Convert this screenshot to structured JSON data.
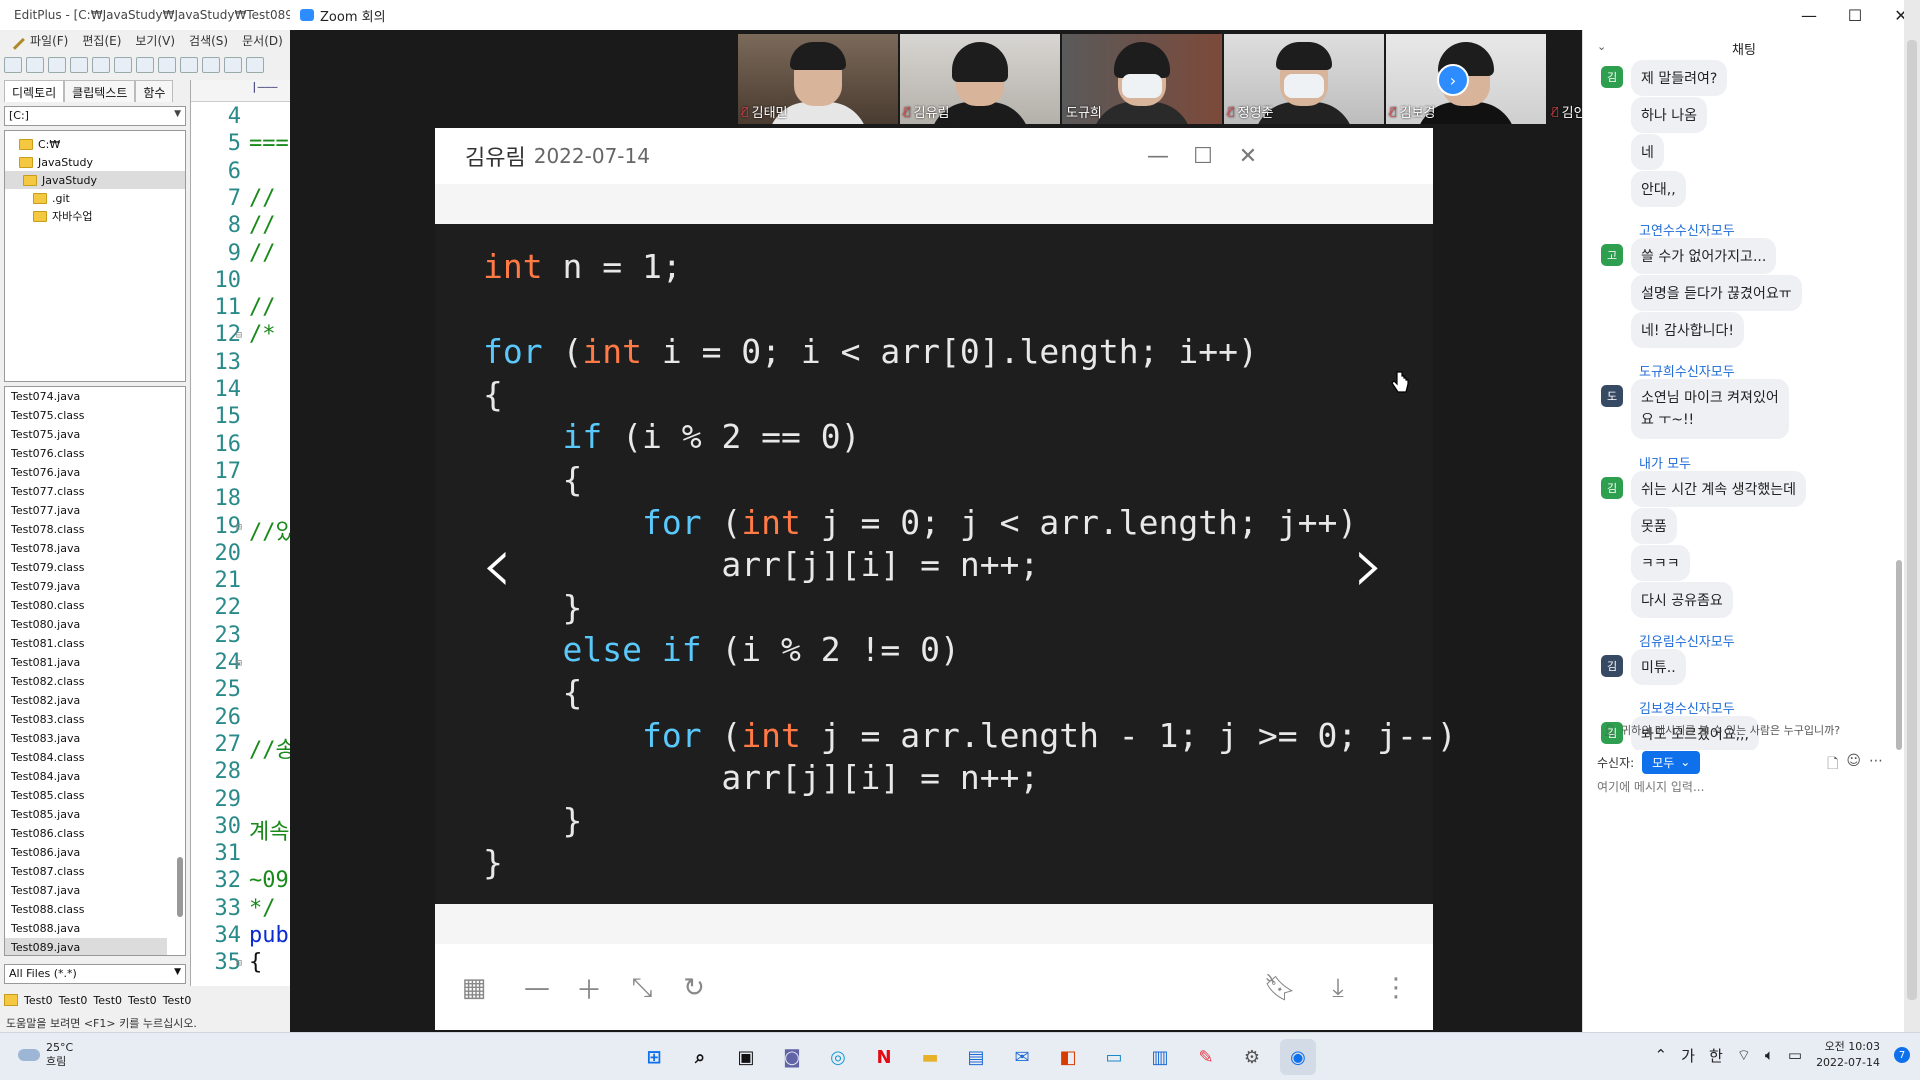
{
  "editplus": {
    "title": "EditPlus - [C:₩JavaStudy₩JavaStudy₩Test089.ja",
    "menu": [
      "파일(F)",
      "편집(E)",
      "보기(V)",
      "검색(S)",
      "문서(D)"
    ],
    "panel_tabs": [
      "디렉토리",
      "클립텍스트",
      "함수"
    ],
    "drive": "[C:]",
    "tree": [
      "C:₩",
      "JavaStudy",
      "JavaStudy",
      ".git",
      "자바수업"
    ],
    "files": [
      "Test074.java",
      "Test075.class",
      "Test075.java",
      "Test076.class",
      "Test076.java",
      "Test077.class",
      "Test077.java",
      "Test078.class",
      "Test078.java",
      "Test079.class",
      "Test079.java",
      "Test080.class",
      "Test080.java",
      "Test081.class",
      "Test081.java",
      "Test082.class",
      "Test082.java",
      "Test083.class",
      "Test083.java",
      "Test084.class",
      "Test084.java",
      "Test085.class",
      "Test085.java",
      "Test086.class",
      "Test086.java",
      "Test087.class",
      "Test087.java",
      "Test088.class",
      "Test088.java",
      "Test089.java"
    ],
    "filter": "All Files (*.*)",
    "ruler": "|———",
    "lines": [
      {
        "n": "4",
        "code": ""
      },
      {
        "n": "5",
        "code": "===",
        "cls": "green"
      },
      {
        "n": "6",
        "code": ""
      },
      {
        "n": "7",
        "code": "//",
        "cls": "green"
      },
      {
        "n": "8",
        "code": "//",
        "cls": "green"
      },
      {
        "n": "9",
        "code": "//",
        "cls": "green"
      },
      {
        "n": "10",
        "code": ""
      },
      {
        "n": "11",
        "code": "//",
        "cls": "green"
      },
      {
        "n": "12",
        "code": "/*",
        "cls": "green",
        "fold": "⊟"
      },
      {
        "n": "13",
        "code": ""
      },
      {
        "n": "14",
        "code": ""
      },
      {
        "n": "15",
        "code": ""
      },
      {
        "n": "16",
        "code": ""
      },
      {
        "n": "17",
        "code": ""
      },
      {
        "n": "18",
        "code": ""
      },
      {
        "n": "19",
        "code": "//있",
        "cls": "green",
        "fold": "⊟"
      },
      {
        "n": "20",
        "code": ""
      },
      {
        "n": "21",
        "code": ""
      },
      {
        "n": "22",
        "code": ""
      },
      {
        "n": "23",
        "code": ""
      },
      {
        "n": "24",
        "code": "",
        "fold": "⊟"
      },
      {
        "n": "25",
        "code": ""
      },
      {
        "n": "26",
        "code": ""
      },
      {
        "n": "27",
        "code": "//송",
        "cls": "green"
      },
      {
        "n": "28",
        "code": ""
      },
      {
        "n": "29",
        "code": ""
      },
      {
        "n": "30",
        "code": "계속",
        "cls": "green"
      },
      {
        "n": "31",
        "code": ""
      },
      {
        "n": "32",
        "code": "~09",
        "cls": "green"
      },
      {
        "n": "33",
        "code": "*/",
        "cls": "green"
      },
      {
        "n": "34",
        "code": "pub",
        "cls": "blue"
      },
      {
        "n": "35",
        "code": "{",
        "fold": "⊟"
      }
    ],
    "doc_tabs": [
      "Test0",
      "Test0",
      "Test0",
      "Test0",
      "Test0"
    ],
    "status": "도움말을 보려면 <F1> 키를 누르십시오."
  },
  "zoom": {
    "window_title": "Zoom 회의",
    "participants": [
      {
        "name": "김태민",
        "muted": true
      },
      {
        "name": "김유림",
        "muted": true
      },
      {
        "name": "도규희",
        "muted": false,
        "active": true
      },
      {
        "name": "정영준",
        "muted": true
      },
      {
        "name": "김보경",
        "muted": true
      },
      {
        "name": "김인교",
        "muted": true,
        "video_off": true
      }
    ],
    "viewer": {
      "sender": "김유림",
      "date": "2022-07-14",
      "code_lines": [
        [
          [
            "int",
            "ty"
          ],
          [
            " n = 1;",
            ""
          ]
        ],
        [],
        [
          [
            "for",
            "kw"
          ],
          [
            " (",
            ""
          ],
          [
            "int",
            "ty"
          ],
          [
            " i = 0; i < arr[0].length; i++)",
            ""
          ]
        ],
        [
          [
            "{",
            ""
          ]
        ],
        [
          [
            "    ",
            ""
          ],
          [
            "if",
            "kw"
          ],
          [
            " (i % 2 == 0)",
            ""
          ]
        ],
        [
          [
            "    {",
            ""
          ]
        ],
        [
          [
            "        ",
            ""
          ],
          [
            "for",
            "kw"
          ],
          [
            " (",
            ""
          ],
          [
            "int",
            "ty"
          ],
          [
            " j = 0; j < arr.length; j++)",
            ""
          ]
        ],
        [
          [
            "            arr[j][i] = n++;",
            ""
          ]
        ],
        [
          [
            "    }",
            ""
          ]
        ],
        [
          [
            "    ",
            ""
          ],
          [
            "else if",
            "kw"
          ],
          [
            " (i % 2 != 0)",
            ""
          ]
        ],
        [
          [
            "    {",
            ""
          ]
        ],
        [
          [
            "        ",
            ""
          ],
          [
            "for",
            "kw"
          ],
          [
            " (",
            ""
          ],
          [
            "int",
            "ty"
          ],
          [
            " j = arr.length - 1; j >= 0; j--)",
            ""
          ]
        ],
        [
          [
            "            arr[j][i] = n++;",
            ""
          ]
        ],
        [
          [
            "    }",
            ""
          ]
        ],
        [
          [
            "}",
            ""
          ]
        ]
      ]
    },
    "chat": {
      "title": "채팅",
      "messages": [
        {
          "avatar": "김",
          "avatar_color": "#2e9e4f",
          "text": "제 말들려여?"
        },
        {
          "text": "하나 나옴"
        },
        {
          "text": "네"
        },
        {
          "text": "안대,,"
        },
        {
          "sender": "고연수",
          "to": "수신자",
          "target": "모두",
          "avatar": "고",
          "avatar_color": "#2e9e4f",
          "text": "쓸 수가 없어가지고..."
        },
        {
          "text": "설명을 듣다가 끊겼어요ㅠ"
        },
        {
          "text": "네! 감사합니다!"
        },
        {
          "sender": "도규희",
          "to": "수신자",
          "target": "모두",
          "avatar": "도",
          "avatar_color": "#374a63",
          "text": "소연님 마이크 켜져있어요 ㅜ~!!",
          "multiline": true
        },
        {
          "sender": "내가",
          "to": "",
          "target": "모두",
          "avatar": "김",
          "avatar_color": "#2e9e4f",
          "text": "쉬는 시간 계속 생각했는데"
        },
        {
          "text": "못품"
        },
        {
          "text": "ㅋㅋㅋ"
        },
        {
          "text": "다시 공유좀요"
        },
        {
          "sender": "김유림",
          "to": "수신자",
          "target": "모두",
          "avatar": "김",
          "avatar_color": "#374a63",
          "text": "미튜.."
        },
        {
          "sender": "김보경",
          "to": "수신자",
          "target": "모두",
          "avatar": "김",
          "avatar_color": "#2e9e4f",
          "text": "봐도 모르겠어요,,,"
        }
      ],
      "who_can_see": "귀하의 메시지를 볼 수 있는 사람은 누구입니까?",
      "recipient_label": "수신자:",
      "recipient_value": "모두",
      "input_placeholder": "여기에 메시지 입력..."
    }
  },
  "taskbar": {
    "temperature": "25°C",
    "weather": "흐림",
    "ime_mode": "가",
    "ime_lang": "한",
    "time": "오전 10:03",
    "date": "2022-07-14",
    "notifications": "7"
  }
}
